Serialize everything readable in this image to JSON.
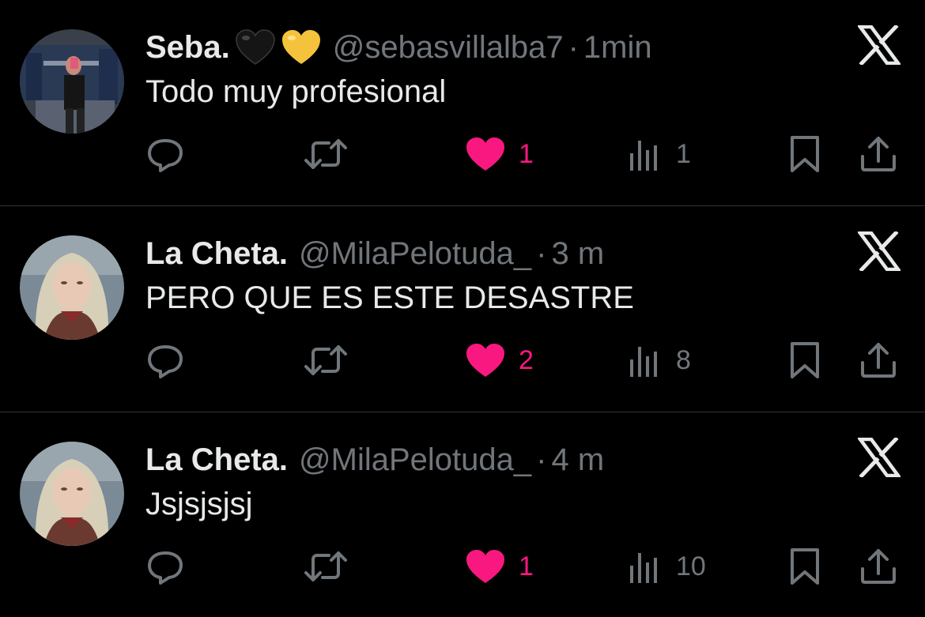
{
  "colors": {
    "background": "#000000",
    "text": "#e7e9ea",
    "muted": "#71767b",
    "like": "#f91880",
    "divider": "#2f3336"
  },
  "tweets": [
    {
      "name": "Seba.",
      "emojis": [
        "black-heart",
        "yellow-heart"
      ],
      "handle": "@sebasvillalba7",
      "separator": "·",
      "time": "1min",
      "text": "Todo muy profesional",
      "likes": "1",
      "views": "1",
      "liked": true
    },
    {
      "name": "La Cheta.",
      "emojis": [],
      "handle": "@MilaPelotuda_",
      "separator": "·",
      "time": "3 m",
      "text": "PERO QUE ES ESTE DESASTRE",
      "likes": "2",
      "views": "8",
      "liked": true
    },
    {
      "name": "La Cheta.",
      "emojis": [],
      "handle": "@MilaPelotuda_",
      "separator": "·",
      "time": "4 m",
      "text": "Jsjsjsjsj",
      "likes": "1",
      "views": "10",
      "liked": true
    }
  ],
  "icons": [
    "x-logo-icon",
    "reply-icon",
    "retweet-icon",
    "heart-icon",
    "views-icon",
    "bookmark-icon",
    "share-icon"
  ]
}
